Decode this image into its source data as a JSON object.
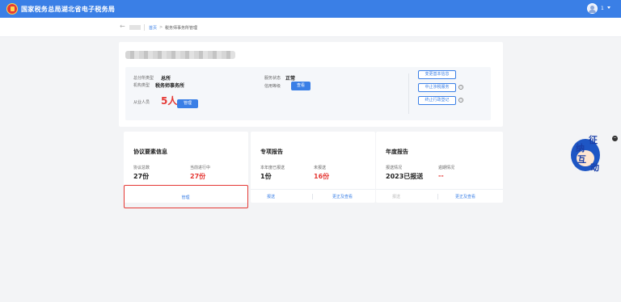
{
  "header": {
    "title": "国家税务总局湖北省电子税务局",
    "user_name": "1"
  },
  "breadcrumb": {
    "back_label": "返回",
    "home": "首页",
    "separator": ">",
    "current": "税务师事务所管理"
  },
  "firm": {
    "branch_type_label": "总分所类型",
    "branch_type_value": "总所",
    "org_type_label": "机构类型",
    "org_type_value": "税务师事务所",
    "service_status_label": "服务状态",
    "service_status_value": "正常",
    "credit_label": "信用等级",
    "credit_button": "查看",
    "staff_label": "从业人员",
    "staff_count": "5人",
    "staff_manage_button": "管理",
    "actions": [
      {
        "label": "变更基本信息"
      },
      {
        "label": "中止涉税服务"
      },
      {
        "label": "终止行政登记"
      }
    ]
  },
  "cards": {
    "agreement": {
      "title": "协议要素信息",
      "total_label": "协议总数",
      "total_value": "27份",
      "active_label": "当前进行中",
      "active_value": "27份",
      "manage_link": "管理"
    },
    "special_report": {
      "title": "专项报告",
      "reported_label": "本年度已报送",
      "reported_value": "1份",
      "unreported_label": "未报送",
      "unreported_value": "16份",
      "link_report": "报送",
      "link_correct": "更正及查看"
    },
    "annual_report": {
      "title": "年度报告",
      "status_label": "报送情况",
      "status_value": "2023已报送",
      "overdue_label": "逾期情况",
      "overdue_value": "--",
      "link_report": "报送",
      "link_correct": "更正及查看"
    }
  },
  "mascot": {
    "chars": [
      "征",
      "纳",
      "互",
      "动"
    ],
    "close": "−"
  },
  "colors": {
    "brand_blue": "#3a7fe6",
    "highlight_red": "#e53935"
  }
}
